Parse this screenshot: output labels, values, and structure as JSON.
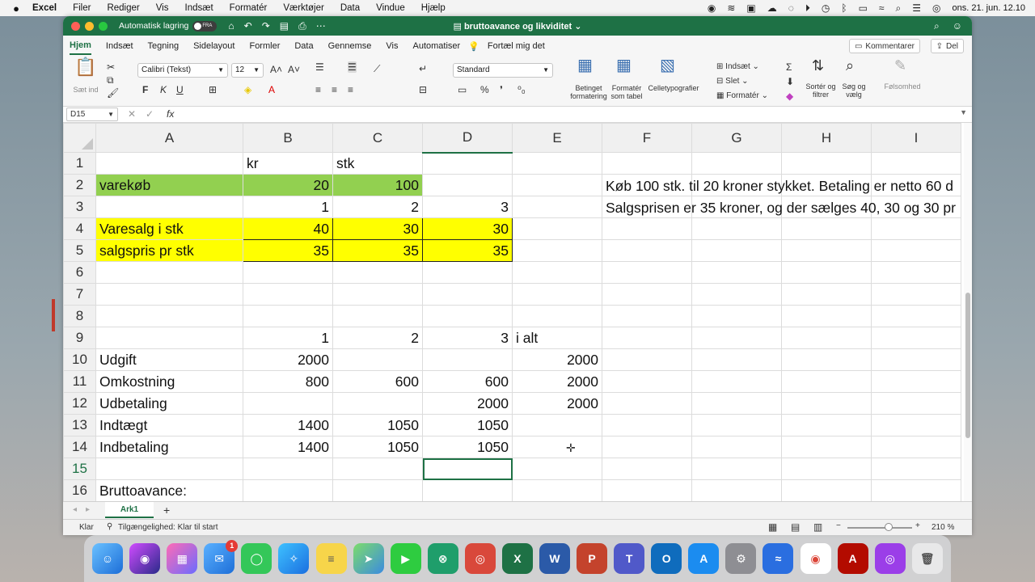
{
  "menubar": {
    "app": "Excel",
    "items": [
      "Filer",
      "Rediger",
      "Vis",
      "Indsæt",
      "Formatér",
      "Værktøjer",
      "Data",
      "Vindue",
      "Hjælp"
    ],
    "datetime": "ons. 21. jun. 12.10"
  },
  "titlebar": {
    "autosave_label": "Automatisk lagring",
    "autosave_state": "FRA",
    "title": "bruttoavance og likviditet"
  },
  "tabs": [
    "Hjem",
    "Indsæt",
    "Tegning",
    "Sidelayout",
    "Formler",
    "Data",
    "Gennemse",
    "Vis",
    "Automatiser"
  ],
  "tellme": "Fortæl mig det",
  "comments_label": "Kommentarer",
  "share_label": "Del",
  "ribbon": {
    "paste_label": "Sæt ind",
    "font_name": "Calibri (Tekst)",
    "font_size": "12",
    "bold": "F",
    "italic": "K",
    "underline": "U",
    "number_format": "Standard",
    "cond_format": "Betinget formatering",
    "format_table": "Formatér som tabel",
    "cell_styles": "Celletypografier",
    "insert": "Indsæt",
    "delete": "Slet",
    "format": "Formatér",
    "sort_filter": "Sortér og filtrer",
    "find_select": "Søg og vælg",
    "sensitivity": "Følsomhed"
  },
  "formula_bar": {
    "namebox": "D15",
    "fx": "fx",
    "value": ""
  },
  "columns": [
    "A",
    "B",
    "C",
    "D",
    "E",
    "F",
    "G",
    "H",
    "I"
  ],
  "rows": [
    {
      "n": "1",
      "A": "",
      "B": "kr",
      "C": "stk",
      "D": "",
      "E": ""
    },
    {
      "n": "2",
      "A": "varekøb",
      "B": "20",
      "C": "100",
      "D": "",
      "E": "",
      "F": "Køb 100 stk. til 20 kroner stykket. Betaling er netto 60 d"
    },
    {
      "n": "3",
      "A": "",
      "B": "1",
      "C": "2",
      "D": "3",
      "E": "",
      "F": "Salgsprisen er 35 kroner, og der sælges 40, 30 og 30 pr"
    },
    {
      "n": "4",
      "A": "Varesalg i stk",
      "B": "40",
      "C": "30",
      "D": "30",
      "E": ""
    },
    {
      "n": "5",
      "A": "salgspris pr stk",
      "B": "35",
      "C": "35",
      "D": "35",
      "E": ""
    },
    {
      "n": "6",
      "A": "",
      "B": "",
      "C": "",
      "D": "",
      "E": ""
    },
    {
      "n": "7",
      "A": "",
      "B": "",
      "C": "",
      "D": "",
      "E": ""
    },
    {
      "n": "8",
      "A": "",
      "B": "",
      "C": "",
      "D": "",
      "E": ""
    },
    {
      "n": "9",
      "A": "",
      "B": "1",
      "C": "2",
      "D": "3",
      "E": "i alt"
    },
    {
      "n": "10",
      "A": "Udgift",
      "B": "2000",
      "C": "",
      "D": "",
      "E": "2000"
    },
    {
      "n": "11",
      "A": "Omkostning",
      "B": "800",
      "C": "600",
      "D": "600",
      "E": "2000"
    },
    {
      "n": "12",
      "A": "Udbetaling",
      "B": "",
      "C": "",
      "D": "2000",
      "E": "2000"
    },
    {
      "n": "13",
      "A": "Indtægt",
      "B": "1400",
      "C": "1050",
      "D": "1050",
      "E": ""
    },
    {
      "n": "14",
      "A": "Indbetaling",
      "B": "1400",
      "C": "1050",
      "D": "1050",
      "E": ""
    },
    {
      "n": "15",
      "A": "",
      "B": "",
      "C": "",
      "D": "",
      "E": ""
    },
    {
      "n": "16",
      "A": "Bruttoavance:",
      "B": "",
      "C": "",
      "D": "",
      "E": ""
    }
  ],
  "sheet_tab": "Ark1",
  "status": {
    "ready": "Klar",
    "accessibility": "Tilgængelighed: Klar til start",
    "zoom": "210 %"
  },
  "dock_badge": "1"
}
